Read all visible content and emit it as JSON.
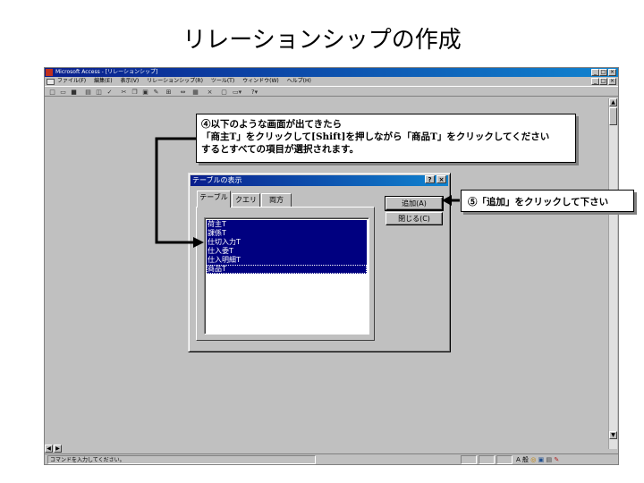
{
  "slide": {
    "title": "リレーションシップの作成"
  },
  "window": {
    "title": "Microsoft Access - [リレーションシップ]",
    "caption_buttons": [
      "_",
      "□",
      "×"
    ],
    "menu": [
      "ファイル(F)",
      "編集(E)",
      "表示(V)",
      "リレーションシップ(R)",
      "ツール(T)",
      "ウィンドウ(W)",
      "ヘルプ(H)"
    ],
    "toolbar_icons": [
      "new-icon",
      "open-icon",
      "save-icon",
      "print-icon",
      "preview-icon",
      "spell-icon",
      "cut-icon",
      "copy-icon",
      "paste-icon",
      "format-icon",
      "show-table-icon",
      "show-direct-icon",
      "show-all-icon",
      "delete-icon",
      "db-window-icon",
      "new-object-icon",
      "help-icon"
    ],
    "status_text": "コマンドを入力してください。",
    "tray_text": "A 般"
  },
  "callouts": {
    "instruction_lines": [
      "④以下のような画面が出てきたら",
      "「商主T」をクリックして[Shift]を押しながら「商品T」をクリックしてください",
      "するとすべての項目が選択されます。"
    ],
    "add_hint": "⑤「追加」をクリックして下さい"
  },
  "dialog": {
    "title": "テーブルの表示",
    "help": "?",
    "close": "×",
    "tabs": [
      "テーブル",
      "クエリ",
      "両方"
    ],
    "tables": [
      "荷主T",
      "課係T",
      "仕切入力T",
      "仕入委T",
      "仕入明細T",
      "商品T"
    ],
    "add_button": "追加(A)",
    "close_button": "閉じる(C)"
  },
  "colors": {
    "selection": "#000080",
    "titlebar": "#0a1e8c",
    "face": "#c0c0c0"
  }
}
